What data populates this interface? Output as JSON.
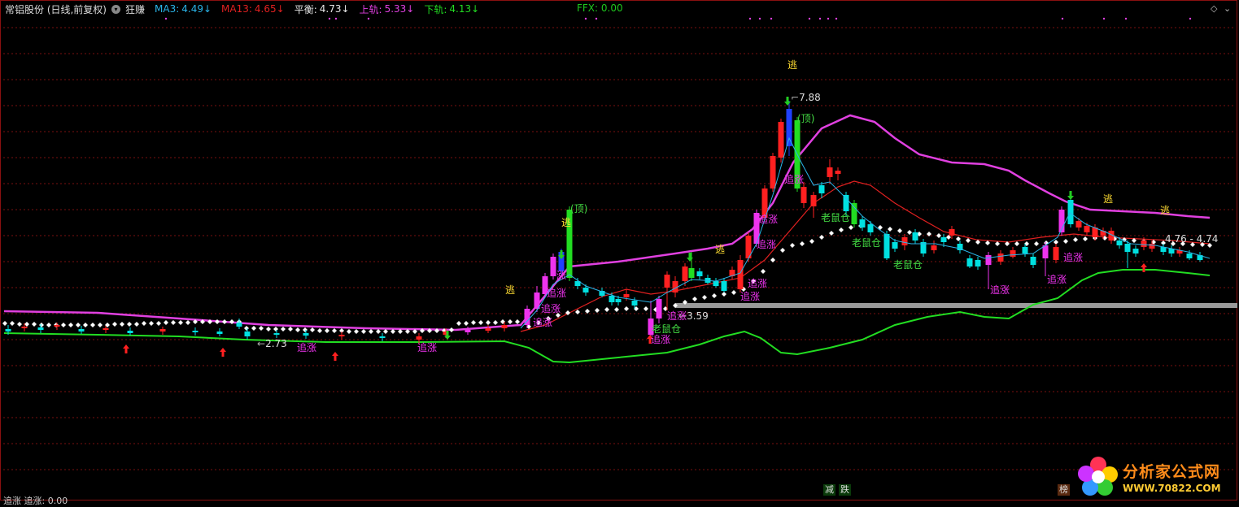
{
  "header": {
    "stock": "常铝股份 (日线,前复权)",
    "indicator": "狂赚",
    "ma3_label": "MA3:",
    "ma3_value": "4.49",
    "ma13_label": "MA13:",
    "ma13_value": "4.65",
    "balance_label": "平衡:",
    "balance_value": "4.73",
    "upper_label": "上轨:",
    "upper_value": "5.33",
    "lower_label": "下轨:",
    "lower_value": "4.13",
    "down_arrow": "↓",
    "ffx": "FFX: 0.00"
  },
  "colors": {
    "ma3": "#2ab4e8",
    "ma13": "#e02020",
    "upper": "#e040e0",
    "lower": "#22dd22",
    "grid": "#7a1010",
    "up_candle": "#ff2020",
    "down_candle": "#00e0e0",
    "zhang": "#ee33ee",
    "laoshu": "#44dd44",
    "tao": "#ffdd33"
  },
  "price_labels": {
    "high": "7.88",
    "low1": "2.73",
    "low2": "3.59",
    "last": "4.76 - 4.74"
  },
  "signals": {
    "escape": "逃",
    "top": "顶",
    "rise": "追涨",
    "rise_short": "涨",
    "rat": "老鼠仓"
  },
  "bottom_tags": {
    "reduce": "减",
    "fall": "跌",
    "rank": "榜"
  },
  "bottom_panel": "追涨  追涨: 0.00",
  "logo": {
    "title": "分析家公式网",
    "url": "WWW.70822.COM"
  }
}
